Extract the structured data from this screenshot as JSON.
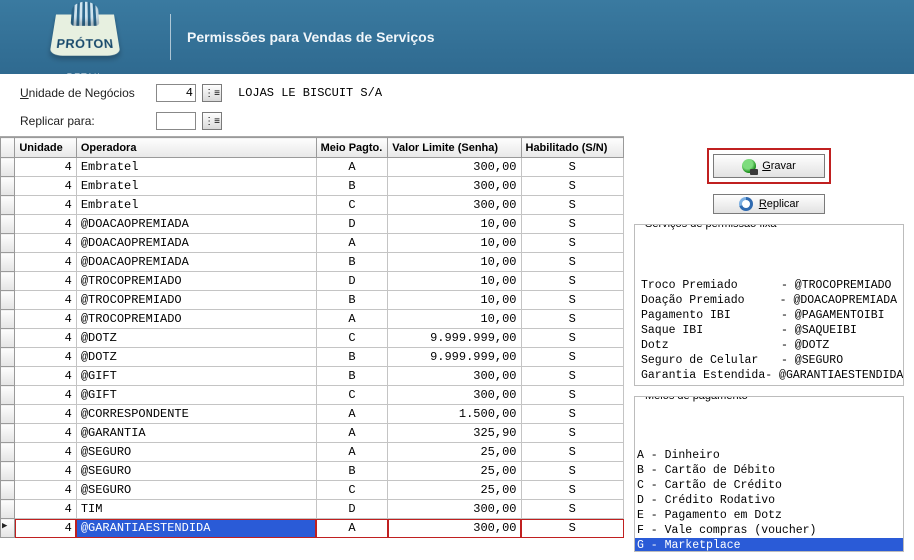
{
  "header": {
    "brand_top": "PRÓTON",
    "brand_sub": "RETAIL",
    "title": "Permissões para Vendas de Serviços"
  },
  "form": {
    "unit_label_pre": "U",
    "unit_label_rest": "nidade de Negócios",
    "unit_value": "4",
    "unit_name": "LOJAS LE BISCUIT S/A",
    "replicate_label": "Replicar para:",
    "replicate_value": ""
  },
  "grid": {
    "columns": {
      "unidade": "Unidade",
      "operadora": "Operadora",
      "meio_pagto": "Meio Pagto.",
      "valor_limite": "Valor Limite (Senha)",
      "habilitado": "Habilitado (S/N)"
    },
    "rows": [
      {
        "unidade": "4",
        "operadora": "Embratel",
        "meio": "A",
        "valor": "300,00",
        "hab": "S"
      },
      {
        "unidade": "4",
        "operadora": "Embratel",
        "meio": "B",
        "valor": "300,00",
        "hab": "S"
      },
      {
        "unidade": "4",
        "operadora": "Embratel",
        "meio": "C",
        "valor": "300,00",
        "hab": "S"
      },
      {
        "unidade": "4",
        "operadora": "@DOACAOPREMIADA",
        "meio": "D",
        "valor": "10,00",
        "hab": "S"
      },
      {
        "unidade": "4",
        "operadora": "@DOACAOPREMIADA",
        "meio": "A",
        "valor": "10,00",
        "hab": "S"
      },
      {
        "unidade": "4",
        "operadora": "@DOACAOPREMIADA",
        "meio": "B",
        "valor": "10,00",
        "hab": "S"
      },
      {
        "unidade": "4",
        "operadora": "@TROCOPREMIADO",
        "meio": "D",
        "valor": "10,00",
        "hab": "S"
      },
      {
        "unidade": "4",
        "operadora": "@TROCOPREMIADO",
        "meio": "B",
        "valor": "10,00",
        "hab": "S"
      },
      {
        "unidade": "4",
        "operadora": "@TROCOPREMIADO",
        "meio": "A",
        "valor": "10,00",
        "hab": "S"
      },
      {
        "unidade": "4",
        "operadora": "@DOTZ",
        "meio": "C",
        "valor": "9.999.999,00",
        "hab": "S"
      },
      {
        "unidade": "4",
        "operadora": "@DOTZ",
        "meio": "B",
        "valor": "9.999.999,00",
        "hab": "S"
      },
      {
        "unidade": "4",
        "operadora": "@GIFT",
        "meio": "B",
        "valor": "300,00",
        "hab": "S"
      },
      {
        "unidade": "4",
        "operadora": "@GIFT",
        "meio": "C",
        "valor": "300,00",
        "hab": "S"
      },
      {
        "unidade": "4",
        "operadora": "@CORRESPONDENTE",
        "meio": "A",
        "valor": "1.500,00",
        "hab": "S"
      },
      {
        "unidade": "4",
        "operadora": "@GARANTIA",
        "meio": "A",
        "valor": "325,90",
        "hab": "S"
      },
      {
        "unidade": "4",
        "operadora": "@SEGURO",
        "meio": "A",
        "valor": "25,00",
        "hab": "S"
      },
      {
        "unidade": "4",
        "operadora": "@SEGURO",
        "meio": "B",
        "valor": "25,00",
        "hab": "S"
      },
      {
        "unidade": "4",
        "operadora": "@SEGURO",
        "meio": "C",
        "valor": "25,00",
        "hab": "S"
      },
      {
        "unidade": "4",
        "operadora": "TIM",
        "meio": "D",
        "valor": "300,00",
        "hab": "S"
      },
      {
        "unidade": "4",
        "operadora": "@GARANTIAESTENDIDA",
        "meio": "A",
        "valor": "300,00",
        "hab": "S",
        "active": true
      }
    ]
  },
  "actions": {
    "save_pre": "G",
    "save_rest": "ravar",
    "replicate_pre": "R",
    "replicate_rest": "eplicar"
  },
  "fixed_box": {
    "legend": "Serviços de permissão fixa",
    "items": [
      {
        "name": "Troco Premiado",
        "code": "@TROCOPREMIADO"
      },
      {
        "name": "Doação Premiado",
        "code": "@DOACAOPREMIADA"
      },
      {
        "name": "Pagamento IBI",
        "code": "@PAGAMENTOIBI"
      },
      {
        "name": "Saque IBI",
        "code": "@SAQUEIBI"
      },
      {
        "name": "Dotz",
        "code": "@DOTZ"
      },
      {
        "name": "Seguro de Celular",
        "code": "@SEGURO"
      },
      {
        "name": "Garantia Estendida",
        "code": "@GARANTIAESTENDIDA"
      }
    ]
  },
  "payments_box": {
    "legend": "Meios de pagamento",
    "items": [
      {
        "label": "A - Dinheiro"
      },
      {
        "label": "B - Cartão de Débito"
      },
      {
        "label": "C - Cartão de Crédito"
      },
      {
        "label": "D - Crédito Rodativo"
      },
      {
        "label": "E - Pagamento em Dotz"
      },
      {
        "label": "F - Vale compras (voucher)"
      },
      {
        "label": "G - Marketplace",
        "selected": true
      }
    ]
  }
}
